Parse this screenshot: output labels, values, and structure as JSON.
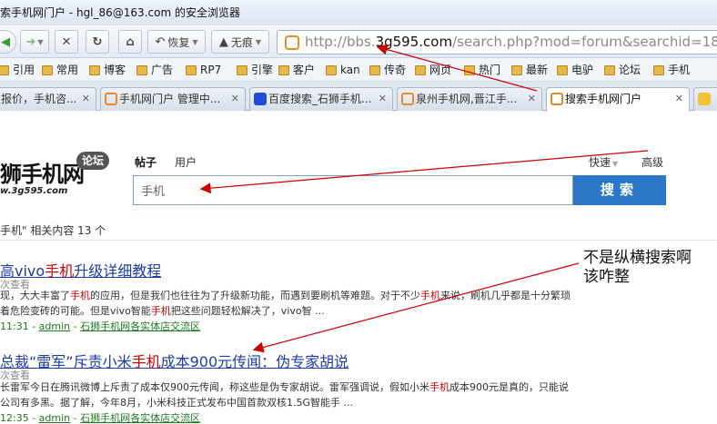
{
  "window": {
    "title": "索手机网门户 - hgl_86@163.com 的安全浏览器"
  },
  "toolbar": {
    "restore_label": "恢复",
    "no_trace_label": "无痕",
    "url_prefix": "http://bbs.",
    "url_host": "3g595.com",
    "url_path": "/search.php?mod=forum&searchid=18&orderby"
  },
  "favorites": [
    "引用",
    "常用",
    "博客",
    "广告",
    "RP7",
    "引擎",
    "客户",
    "kan",
    "传奇",
    "网页",
    "热门",
    "最新",
    "电驴",
    "论坛",
    "手机"
  ],
  "tabs": [
    {
      "label": "报价，手机咨..."
    },
    {
      "label": "手机网门户 管理中..."
    },
    {
      "label": "百度搜索_石狮手机..."
    },
    {
      "label": "泉州手机网,晋江手..."
    },
    {
      "label": "搜索手机网门户"
    }
  ],
  "site": {
    "logo_text": "狮手机网",
    "logo_sub": "w.3g595.com",
    "logo_badge": "论坛"
  },
  "search": {
    "tab_posts": "帖子",
    "tab_users": "用户",
    "quick_label": "快速",
    "advanced_label": "高级",
    "query": "手机",
    "button_label": "搜索"
  },
  "results_summary": "手机\" 相关内容 13 个",
  "results": [
    {
      "title_pre": "高vivo",
      "title_hl": "手机",
      "title_post": "升级详细教程",
      "meta": "次查看",
      "line1_pre": "现，大大丰富了",
      "line1_hl": "手机",
      "line1_mid": "的应用，但是我们也往往为了升级新功能，而遇到要刷机等难题。对于不少",
      "line1_hl2": "手机",
      "line1_post": "来说，刷机几乎都是十分繁琐",
      "line2_pre": "着危险变砖的可能。但是vivo智能",
      "line2_hl": "手机",
      "line2_post": "把这些问题轻松解决了，vivo智 ...",
      "time": "11:31",
      "author": "admin",
      "forum": "石狮手机网各实体店交流区"
    },
    {
      "title_pre": "总裁“雷军”斥责小米",
      "title_hl": "手机",
      "title_post": "成本900元传闻：伪专家胡说",
      "meta": "次查看",
      "line1_pre": "长雷军今日在腾讯微博上斥责了成本仅900元传闻，称这些是伪专家胡说。雷军强调说，假如小米",
      "line1_hl": "手机",
      "line1_mid": "成本900元是真的，只能说",
      "line1_hl2": "",
      "line1_post": "",
      "line2_pre": "公司有多黑。据了解，今年8月，小米科技正式发布中国首款双核1.5G智能手 ...",
      "line2_hl": "",
      "line2_post": "",
      "time": "12:35",
      "author": "admin",
      "forum": "石狮手机网各实体店交流区"
    }
  ],
  "annotation": "不是纵横搜索啊\n该咋整",
  "colors": {
    "link": "#1a3fa8",
    "highlight": "#cc0000",
    "search_button": "#2b78c9",
    "arrow": "#d00000"
  }
}
